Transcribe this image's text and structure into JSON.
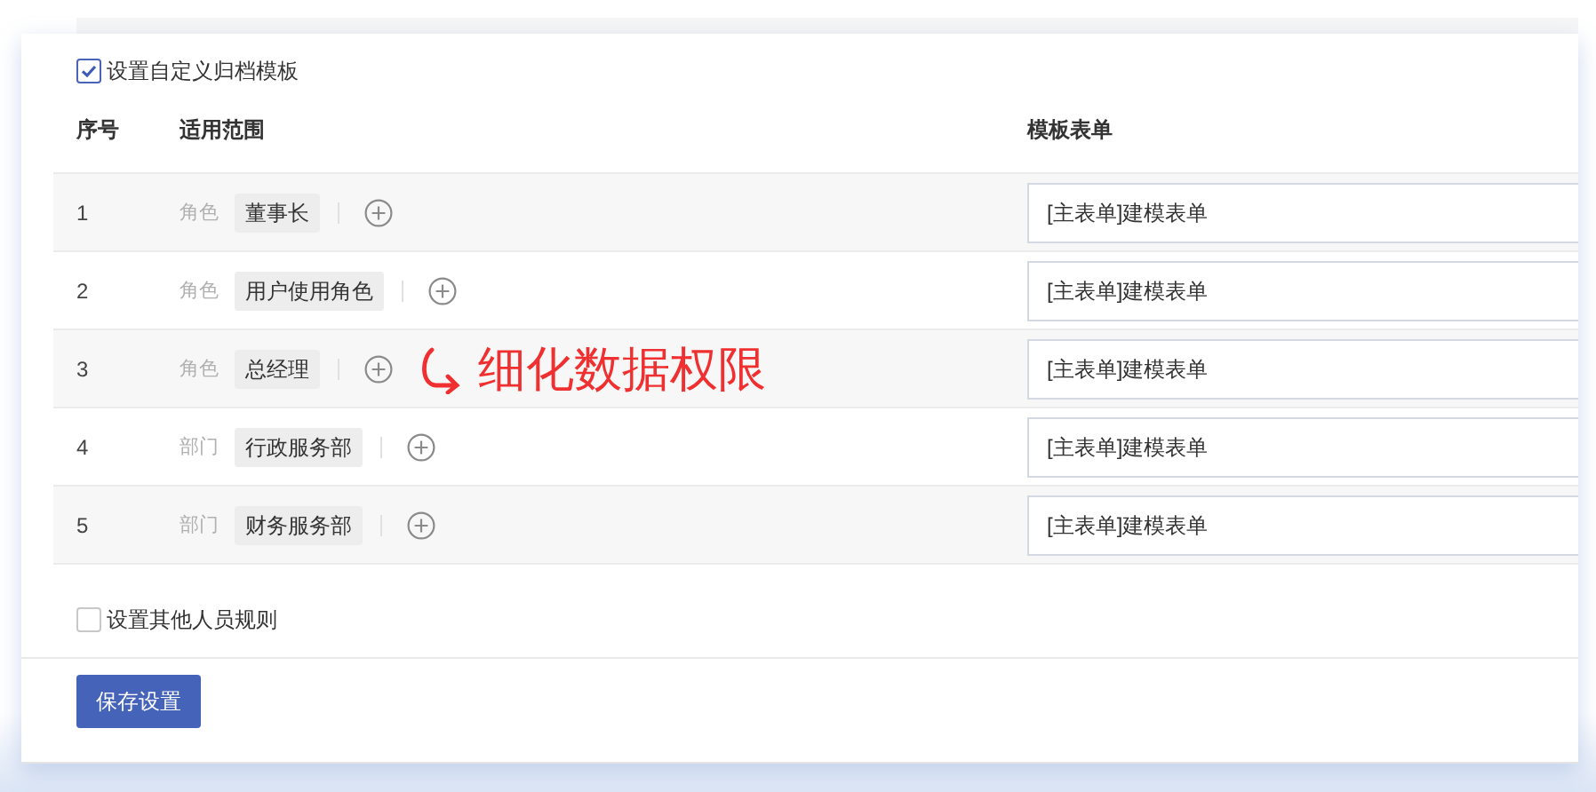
{
  "custom_template": {
    "label": "设置自定义归档模板",
    "checked": true
  },
  "table": {
    "columns": [
      "序号",
      "适用范围",
      "模板表单"
    ],
    "rows": [
      {
        "index": "1",
        "scope_type": "角色",
        "scope": "董事长",
        "template": "[主表单]建模表单"
      },
      {
        "index": "2",
        "scope_type": "角色",
        "scope": "用户使用角色",
        "template": "[主表单]建模表单"
      },
      {
        "index": "3",
        "scope_type": "角色",
        "scope": "总经理",
        "template": "[主表单]建模表单",
        "annotation": "细化数据权限"
      },
      {
        "index": "4",
        "scope_type": "部门",
        "scope": "行政服务部",
        "template": "[主表单]建模表单"
      },
      {
        "index": "5",
        "scope_type": "部门",
        "scope": "财务服务部",
        "template": "[主表单]建模表单"
      }
    ]
  },
  "other_rule": {
    "label": "设置其他人员规则",
    "checked": false
  },
  "save_button": "保存设置"
}
